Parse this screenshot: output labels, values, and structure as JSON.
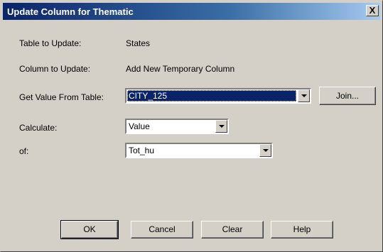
{
  "window": {
    "title": "Update Column for Thematic",
    "close_label": "X"
  },
  "fields": {
    "table_to_update": {
      "label": "Table to Update:",
      "value": "States"
    },
    "column_to_update": {
      "label": "Column to Update:",
      "value": "Add New Temporary Column"
    },
    "get_value_from_table": {
      "label": "Get Value From Table:",
      "value": "CITY_125",
      "selected": true
    },
    "calculate": {
      "label": "Calculate:",
      "value": "Value"
    },
    "of": {
      "label": "of:",
      "value": "Tot_hu"
    }
  },
  "buttons": {
    "join": "Join...",
    "ok": "OK",
    "cancel": "Cancel",
    "clear": "Clear",
    "help": "Help"
  },
  "colors": {
    "title_bar_start": "#0a246a",
    "title_bar_end": "#a6caf0",
    "dialog_face": "#d4d0c8",
    "selection": "#0a246a"
  }
}
